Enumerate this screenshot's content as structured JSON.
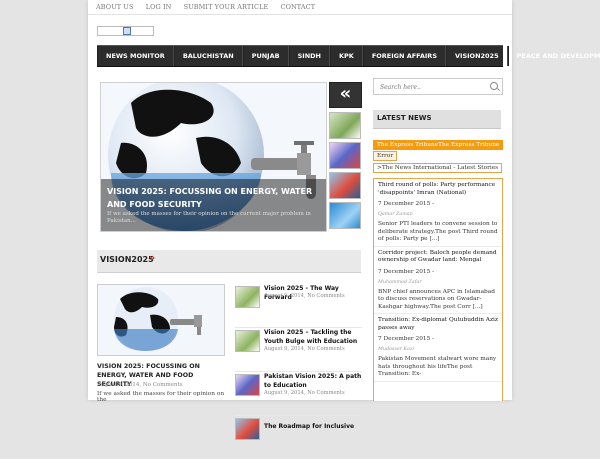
{
  "topnav": [
    "About Us",
    "Log In",
    "Submit Your Article",
    "Contact"
  ],
  "nav": [
    "NEWS MONITOR",
    "BALUCHISTAN",
    "PUNJAB",
    "SINDH",
    "KPK",
    "FOREIGN AFFAIRS",
    "VISION2025",
    "PEACE AND DEVELOPMENT"
  ],
  "slider": {
    "title": "VISION 2025: FOCUSSING ON ENERGY, WATER AND FOOD SECURITY",
    "excerpt": "If we asked the masses for their opinion on the current major problem in Pakistan...",
    "prev_glyph": "«"
  },
  "section": {
    "title": "VISION2025",
    "arrow": "»"
  },
  "featured": {
    "title": "VISION 2025: FOCUSSING ON ENERGY, WATER AND FOOD SECURITY",
    "meta": "August 9, 2014, No Comments",
    "excerpt": "If we asked the masses for their opinion on the"
  },
  "posts": [
    {
      "title": "Vision 2025 - The Way Forward",
      "meta": "August 9, 2014, No Comments"
    },
    {
      "title": "Vision 2025 – Tackling the Youth Bulge with Education",
      "meta": "August 9, 2014, No Comments"
    },
    {
      "title": "Pakistan Vision 2025: A path to Education",
      "meta": "August 9, 2014, No Comments"
    },
    {
      "title": "The Roadmap for Inclusive",
      "meta": ""
    }
  ],
  "sidebar": {
    "search_placeholder": "Search here..",
    "latest_title": "LATEST NEWS",
    "tags": [
      "The Express TribuneThe Express Tribune",
      "Error",
      ">The News International - Latest Stories"
    ],
    "feed": [
      {
        "headline": "Third round of polls: Party performance 'disappoints' Imran (National)",
        "date": "7 December 2015 -",
        "author": "Qamar Zaman",
        "excerpt": "Senior PTI leaders to convene session to deliberate strategy.The post Third round of polls: Party pe [...]"
      },
      {
        "headline": "Corridor project: Baloch people demand ownership of Gwadar land: Mengal",
        "date": "7 December 2015 -",
        "author": "Muhammad Zafar",
        "excerpt": "BNP chief announces APC in Islamabad to discuss reservations on Gwadar-Kashgar highway.The post Corr [...]"
      },
      {
        "headline": "Transition: Ex-diplomat Qutubuddin Aziz passes away",
        "date": "7 December 2015 -",
        "author": "Mudasser Kazi",
        "excerpt": "Pakistan Movement stalwart wore many hats throughout his lifeThe post Transition: Ex-"
      }
    ]
  }
}
